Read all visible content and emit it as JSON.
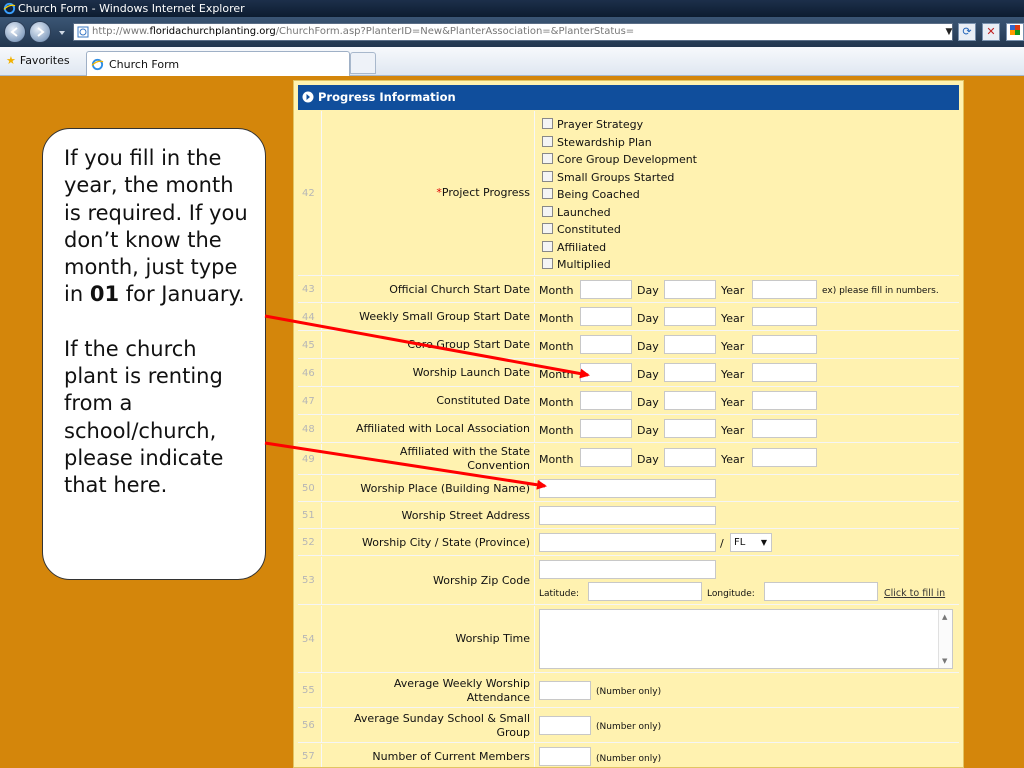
{
  "window": {
    "title": "Church Form - Windows Internet Explorer"
  },
  "address_bar": {
    "url_prefix": "http://www.",
    "url_host": "floridachurchplanting.org",
    "url_path": "/ChurchForm.asp?PlanterID=New&PlanterAssociation=&PlanterStatus=",
    "refresh_glyph": "⟳",
    "stop_glyph": "✕"
  },
  "favorites_bar": {
    "favorites_label": "Favorites",
    "tab_label": "Church Form"
  },
  "colors": {
    "page_bg": "#d4860b",
    "form_bg": "#fff2b0",
    "header_bg": "#104e9c",
    "required": "#dd0000",
    "arrow": "#ff0000"
  },
  "form": {
    "header": "Progress Information",
    "rows": {
      "r42": {
        "num": "42",
        "required_mark": "*",
        "label": "Project Progress",
        "options": [
          "Prayer Strategy",
          "Stewardship Plan",
          "Core Group Development",
          "Small Groups Started",
          "Being Coached",
          "Launched",
          "Constituted",
          "Affiliated",
          "Multiplied"
        ]
      },
      "r43": {
        "num": "43",
        "label": "Official Church Start Date",
        "hint": "ex) please fill in numbers."
      },
      "r44": {
        "num": "44",
        "label": "Weekly Small Group Start Date"
      },
      "r45": {
        "num": "45",
        "label": "Core Group Start Date"
      },
      "r46": {
        "num": "46",
        "label": "Worship Launch Date"
      },
      "r47": {
        "num": "47",
        "label": "Constituted Date"
      },
      "r48": {
        "num": "48",
        "label": "Affiliated with Local Association"
      },
      "r49": {
        "num": "49",
        "label": "Affiliated with the State Convention"
      },
      "r50": {
        "num": "50",
        "label": "Worship Place (Building Name)"
      },
      "r51": {
        "num": "51",
        "label": "Worship Street Address"
      },
      "r52": {
        "num": "52",
        "label": "Worship City / State (Province)",
        "separator": "/",
        "state_value": "FL"
      },
      "r53": {
        "num": "53",
        "label": "Worship Zip Code",
        "latitude_label": "Latitude:",
        "longitude_label": "Longitude:",
        "fill_link": "Click to fill in"
      },
      "r54": {
        "num": "54",
        "label": "Worship Time"
      },
      "r55": {
        "num": "55",
        "label": "Average Weekly Worship Attendance",
        "hint": "(Number only)"
      },
      "r56": {
        "num": "56",
        "label": "Average Sunday School & Small Group",
        "hint": "(Number only)"
      },
      "r57": {
        "num": "57",
        "label": "Number of Current Members",
        "hint": "(Number only)"
      }
    },
    "date_parts": {
      "month": "Month",
      "day": "Day",
      "year": "Year"
    }
  },
  "callout": {
    "p1_before": "If you fill in the year, the month is required.  If you don’t know the month, just type in ",
    "p1_bold": "01",
    "p1_after": " for January.",
    "p2": "If the church plant is renting from a school/church, please indicate that here."
  }
}
